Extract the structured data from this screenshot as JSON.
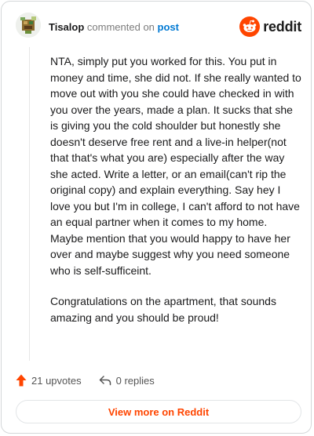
{
  "header": {
    "author": "Tisalop",
    "commented_text": "commented on",
    "post_link": "post",
    "brand": "reddit"
  },
  "comment": {
    "paragraphs": [
      "NTA, simply put you worked for this. You put in money and time, she did not. If she really wanted to move out with you she could have checked in with you over the years, made a plan. It sucks that she is giving you the cold shoulder but honestly she doesn't deserve free rent and a live-in helper(not that that's what you are) especially after the way she acted. Write a letter, or an email(can't rip the original copy) and explain everything. Say hey I love you but I'm in college, I can't afford to not have an equal partner when it comes to my home. Maybe mention that you would happy to have her over and maybe suggest why you need someone who is self-sufficeint.",
      "Congratulations on the apartment, that sounds amazing and you should be proud!"
    ]
  },
  "actions": {
    "upvotes": "21 upvotes",
    "replies": "0 replies"
  },
  "footer": {
    "view_more": "View more on Reddit"
  },
  "colors": {
    "accent": "#ff4500",
    "link": "#0079d3"
  },
  "icons": {
    "upvote": "upvote-arrow-icon",
    "reply": "reply-arrow-icon",
    "brand": "reddit-logo-icon"
  }
}
